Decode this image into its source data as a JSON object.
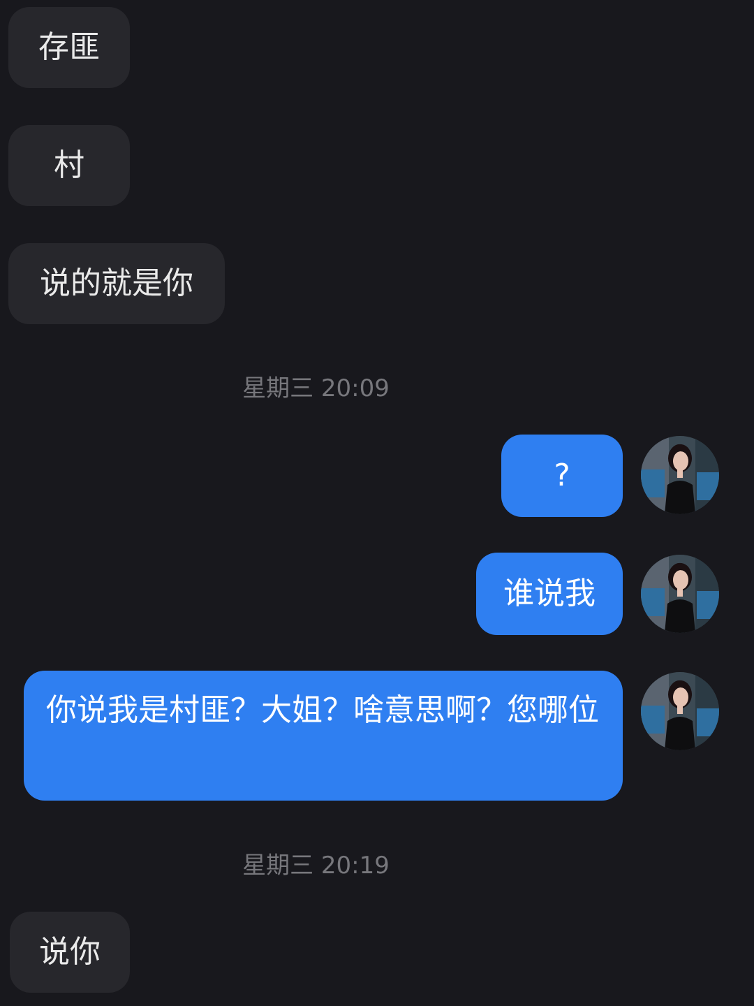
{
  "messages": [
    {
      "side": "received",
      "text": "存匪"
    },
    {
      "side": "received",
      "text": "村"
    },
    {
      "side": "received",
      "text": "说的就是你"
    },
    {
      "type": "timestamp",
      "text": "星期三 20:09"
    },
    {
      "side": "sent",
      "text": "?"
    },
    {
      "side": "sent",
      "text": "谁说我"
    },
    {
      "side": "sent",
      "text": "你说我是村匪？大姐？啥意思啊？您哪位"
    },
    {
      "type": "timestamp",
      "text": "星期三 20:19"
    },
    {
      "side": "received",
      "text": "说你"
    }
  ],
  "avatar_icon": "user-avatar-photo",
  "colors": {
    "background": "#18181d",
    "received_bubble": "#27272c",
    "sent_bubble": "#2f7ff1",
    "timestamp_text": "#77777c"
  }
}
